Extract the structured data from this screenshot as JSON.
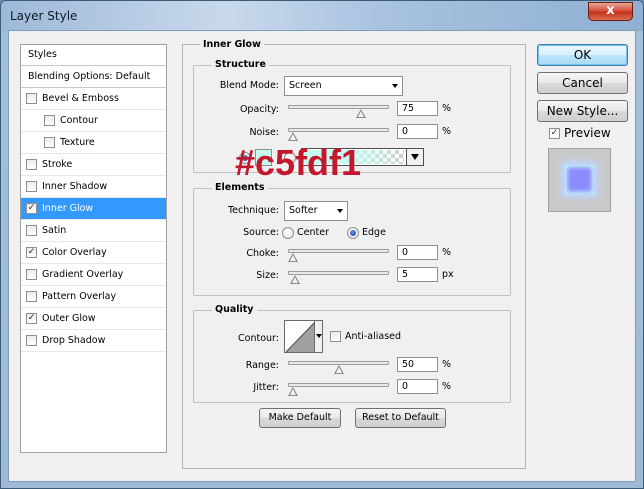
{
  "window": {
    "title": "Layer Style",
    "close_symbol": "x"
  },
  "styles_panel": {
    "header": "Styles",
    "blending_options": "Blending Options: Default",
    "items": [
      {
        "label": "Bevel & Emboss",
        "checked": false,
        "indent": false,
        "selected": false
      },
      {
        "label": "Contour",
        "checked": false,
        "indent": true,
        "selected": false
      },
      {
        "label": "Texture",
        "checked": false,
        "indent": true,
        "selected": false
      },
      {
        "label": "Stroke",
        "checked": false,
        "indent": false,
        "selected": false
      },
      {
        "label": "Inner Shadow",
        "checked": false,
        "indent": false,
        "selected": false
      },
      {
        "label": "Inner Glow",
        "checked": true,
        "indent": false,
        "selected": true
      },
      {
        "label": "Satin",
        "checked": false,
        "indent": false,
        "selected": false
      },
      {
        "label": "Color Overlay",
        "checked": true,
        "indent": false,
        "selected": false
      },
      {
        "label": "Gradient Overlay",
        "checked": false,
        "indent": false,
        "selected": false
      },
      {
        "label": "Pattern Overlay",
        "checked": false,
        "indent": false,
        "selected": false
      },
      {
        "label": "Outer Glow",
        "checked": true,
        "indent": false,
        "selected": false
      },
      {
        "label": "Drop Shadow",
        "checked": false,
        "indent": false,
        "selected": false
      }
    ]
  },
  "inner_glow": {
    "title": "Inner Glow",
    "structure": {
      "title": "Structure",
      "blend_mode_label": "Blend Mode:",
      "blend_mode_value": "Screen",
      "opacity_label": "Opacity:",
      "opacity_value": "75",
      "opacity_unit": "%",
      "opacity_level": 0.75,
      "noise_label": "Noise:",
      "noise_value": "0",
      "noise_unit": "%",
      "noise_level": 0,
      "glow_color": "#c5fdf1"
    },
    "elements": {
      "title": "Elements",
      "technique_label": "Technique:",
      "technique_value": "Softer",
      "source_label": "Source:",
      "source_center": "Center",
      "source_edge": "Edge",
      "source_selected": "Edge",
      "choke_label": "Choke:",
      "choke_value": "0",
      "choke_unit": "%",
      "choke_level": 0,
      "size_label": "Size:",
      "size_value": "5",
      "size_unit": "px",
      "size_level": 0.02
    },
    "quality": {
      "title": "Quality",
      "contour_label": "Contour:",
      "anti_aliased_label": "Anti-aliased",
      "anti_aliased_checked": false,
      "range_label": "Range:",
      "range_value": "50",
      "range_unit": "%",
      "range_level": 0.5,
      "jitter_label": "Jitter:",
      "jitter_value": "0",
      "jitter_unit": "%",
      "jitter_level": 0
    },
    "make_default": "Make Default",
    "reset_to_default": "Reset to Default"
  },
  "side_buttons": {
    "ok": "OK",
    "cancel": "Cancel",
    "new_style": "New Style...",
    "preview_label": "Preview",
    "preview_checked": true
  },
  "overlay_text": "#c5fdf1",
  "colors": {
    "selection": "#3399ff",
    "glow": "#c5fdf1",
    "overlay_text": "#c4172d",
    "preview_swatch": "#8c8cff"
  }
}
